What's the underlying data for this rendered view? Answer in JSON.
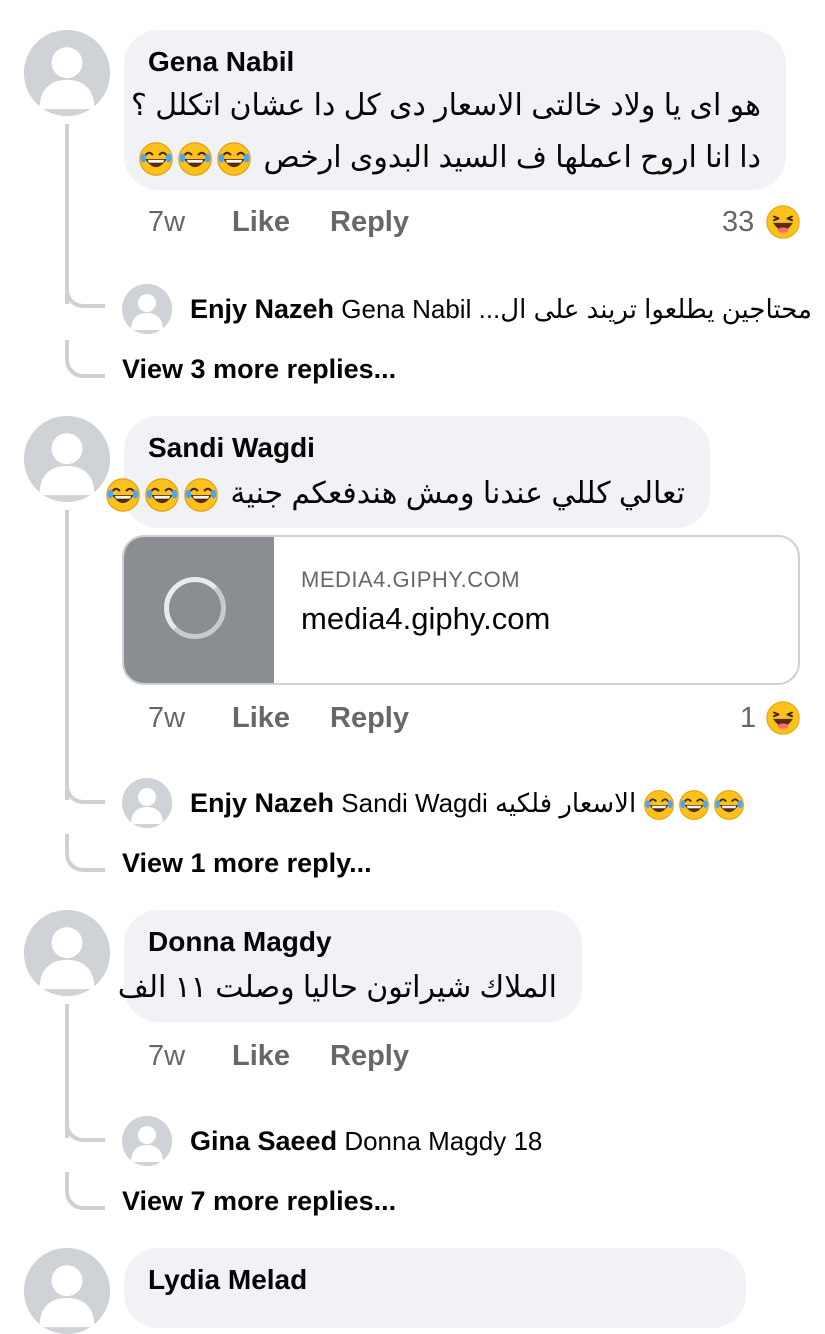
{
  "comments": [
    {
      "author": "Gena Nabil",
      "text_lines": [
        "هو اى يا ولاد خالتى الاسعار دى كل دا عشان اتكلل ؟",
        "دا انا اروح اعملها ف السيد البدوى ارخص"
      ],
      "emojis": [
        "laughing-emoji",
        "laughing-emoji",
        "laughing-emoji"
      ],
      "time": "7w",
      "like_label": "Like",
      "reply_label": "Reply",
      "reaction_count": "33",
      "reaction_icon": "haha-reaction-icon",
      "reply_preview": {
        "name": "Enjy Nazeh",
        "mention": "Gena Nabil",
        "text": "محتاجين يطلعوا تريند على ال..."
      },
      "view_more": "View 3 more replies..."
    },
    {
      "author": "Sandi Wagdi",
      "text_lines": [
        "تعالي كللي عندنا ومش هندفعكم جنية"
      ],
      "emojis": [
        "laughing-emoji",
        "laughing-emoji",
        "laughing-emoji"
      ],
      "link": {
        "domain": "MEDIA4.GIPHY.COM",
        "title": "media4.giphy.com"
      },
      "time": "7w",
      "like_label": "Like",
      "reply_label": "Reply",
      "reaction_count": "1",
      "reaction_icon": "haha-reaction-icon",
      "reply_preview": {
        "name": "Enjy Nazeh",
        "mention": "Sandi Wagdi",
        "text": "الاسعار فلكيه"
      },
      "view_more": "View 1 more reply..."
    },
    {
      "author": "Donna Magdy",
      "text_lines": [
        "الملاك شيراتون حاليا وصلت ١١ الف"
      ],
      "time": "7w",
      "like_label": "Like",
      "reply_label": "Reply",
      "reply_preview": {
        "name": "Gina Saeed",
        "mention": "Donna Magdy",
        "text": "18"
      },
      "view_more": "View 7 more replies..."
    },
    {
      "author": "Lydia Melad"
    }
  ],
  "colors": {
    "bubble": "#f0f2f5",
    "meta": "#65676b",
    "thread_line": "#ced0d4",
    "avatar": "#cfd2d6",
    "emoji": "#fcc21b"
  }
}
